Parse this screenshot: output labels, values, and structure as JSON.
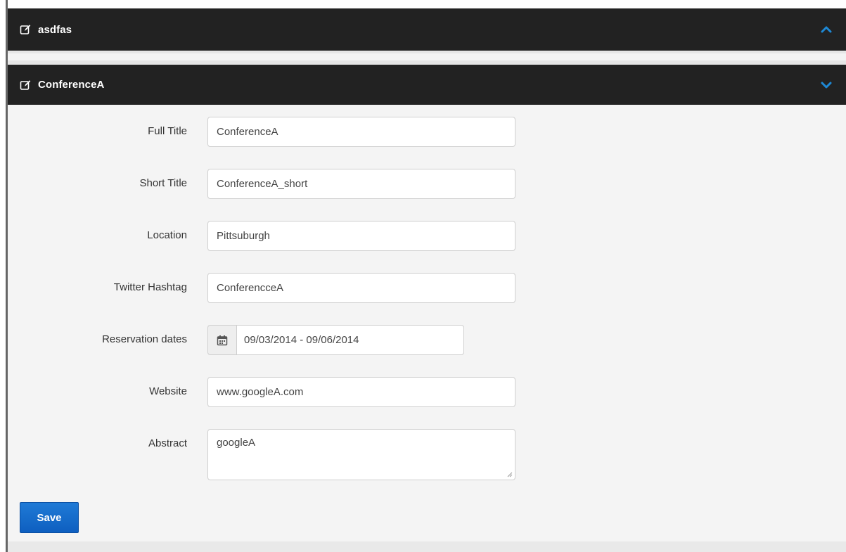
{
  "panels": [
    {
      "title": "asdfas",
      "expanded": false,
      "header_icon": "edit-icon",
      "chevron_icon": "chevron-up-icon",
      "chevron_color": "#1e88d4"
    },
    {
      "title": "ConferenceA",
      "expanded": true,
      "header_icon": "edit-icon",
      "chevron_icon": "chevron-down-icon",
      "chevron_color": "#1e88d4"
    }
  ],
  "form": {
    "full_title": {
      "label": "Full Title",
      "value": "ConferenceA"
    },
    "short_title": {
      "label": "Short Title",
      "value": "ConferenceA_short"
    },
    "location": {
      "label": "Location",
      "value": "Pittsuburgh"
    },
    "twitter_hashtag": {
      "label": "Twitter Hashtag",
      "value": "ConferencceA"
    },
    "reservation_dates": {
      "label": "Reservation dates",
      "value": "09/03/2014 - 09/06/2014",
      "icon": "calendar-icon"
    },
    "website": {
      "label": "Website",
      "value": "www.googleA.com"
    },
    "abstract": {
      "label": "Abstract",
      "value": "googleA"
    }
  },
  "save_label": "Save",
  "colors": {
    "header_bg": "#222222",
    "body_bg": "#f4f4f4",
    "accent": "#1e88d4",
    "button": "#1a6fce"
  }
}
